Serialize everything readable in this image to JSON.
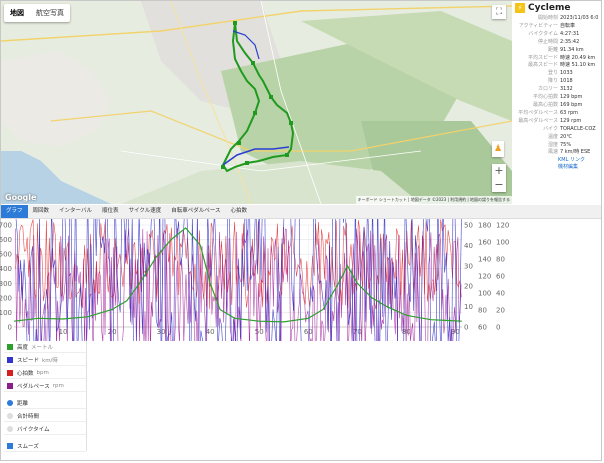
{
  "map": {
    "tabs": [
      {
        "label": "地図",
        "active": true
      },
      {
        "label": "航空写真",
        "active": false
      }
    ],
    "google_logo": "Google",
    "footer_items": [
      "キーボード ショートカット",
      "地図データ ©2023",
      "利用規約",
      "地図の誤りを報告する"
    ]
  },
  "panel": {
    "title": "Cycleme",
    "rows": [
      {
        "label": "開始時刻",
        "value": "2023/11/03 6:0"
      },
      {
        "label": "アクティビティー",
        "value": "自転車"
      },
      {
        "label": "バイクタイム",
        "value": "4:27:31"
      },
      {
        "label": "停止時間",
        "value": "2:35:42"
      },
      {
        "label": "距離",
        "value": "91.34 km"
      },
      {
        "label": "平均スピード",
        "value": "時速 20.49 km"
      },
      {
        "label": "最高スピード",
        "value": "時速 51.10 km"
      },
      {
        "label": "登り",
        "value": "1033"
      },
      {
        "label": "降り",
        "value": "1018"
      },
      {
        "label": "カロリー",
        "value": "3132"
      },
      {
        "label": "平均心拍数",
        "value": "129 bpm"
      },
      {
        "label": "最高心拍数",
        "value": "169 bpm"
      },
      {
        "label": "平均ペダルペース",
        "value": "63 rpm"
      },
      {
        "label": "最高ペダルペース",
        "value": "129 rpm"
      },
      {
        "label": "バイク",
        "value": "TORACLE-COZ"
      },
      {
        "label": "温度",
        "value": "20℃"
      },
      {
        "label": "湿度",
        "value": "75%"
      },
      {
        "label": "風速",
        "value": "7 km/時 ESE"
      }
    ],
    "kml_link": "KML リンク",
    "gear_link": "機材編集"
  },
  "tabs": [
    "グラフ",
    "周回数",
    "インターバル",
    "順位表",
    "サイクル速度",
    "自転車ペダルペース",
    "心拍数"
  ],
  "chart_data": {
    "type": "line",
    "x_ticks": [
      10,
      20,
      30,
      40,
      50,
      60,
      70,
      80,
      90
    ],
    "xlim": [
      0,
      91.34
    ],
    "y_left_ticks": [
      0,
      100,
      200,
      300,
      400,
      500,
      600,
      700
    ],
    "y_mid_ticks": [
      0,
      10,
      20,
      30,
      40,
      50
    ],
    "y_r1_ticks": [
      60,
      80,
      100,
      120,
      140,
      160,
      180
    ],
    "y_r2_ticks": [
      0,
      20,
      40,
      60,
      80,
      100,
      120
    ],
    "series": [
      {
        "name": "高度",
        "unit": "メートル",
        "color": "#2e9e2e",
        "x": [
          0,
          5,
          10,
          15,
          20,
          23,
          26,
          29,
          32,
          35,
          38,
          40,
          42,
          45,
          50,
          55,
          60,
          63,
          66,
          68,
          70,
          73,
          76,
          80,
          85,
          88,
          91.3
        ],
        "y": [
          40,
          60,
          55,
          70,
          120,
          180,
          320,
          480,
          600,
          680,
          560,
          300,
          120,
          60,
          40,
          35,
          60,
          120,
          290,
          420,
          300,
          200,
          140,
          80,
          50,
          45,
          40
        ]
      },
      {
        "name": "スピード",
        "unit": "km/時",
        "color": "#3434c8"
      },
      {
        "name": "心拍数",
        "unit": "bpm",
        "color": "#d62020"
      },
      {
        "name": "ペダルペース",
        "unit": "rpm",
        "color": "#8a1e8a"
      }
    ]
  },
  "legend": {
    "series": [
      {
        "label": "高度",
        "unit": "メートル",
        "color": "#2e9e2e",
        "checked": true
      },
      {
        "label": "スピード",
        "unit": "km/時",
        "color": "#3434c8",
        "checked": true
      },
      {
        "label": "心拍数",
        "unit": "bpm",
        "color": "#d62020",
        "checked": true
      },
      {
        "label": "ペダルペース",
        "unit": "rpm",
        "color": "#8a1e8a",
        "checked": true
      }
    ],
    "axis_options": [
      {
        "label": "距離",
        "selected": true
      },
      {
        "label": "合計時間",
        "selected": false
      },
      {
        "label": "バイクタイム",
        "selected": false
      }
    ],
    "smooth": {
      "label": "スムーズ",
      "checked": true
    }
  }
}
